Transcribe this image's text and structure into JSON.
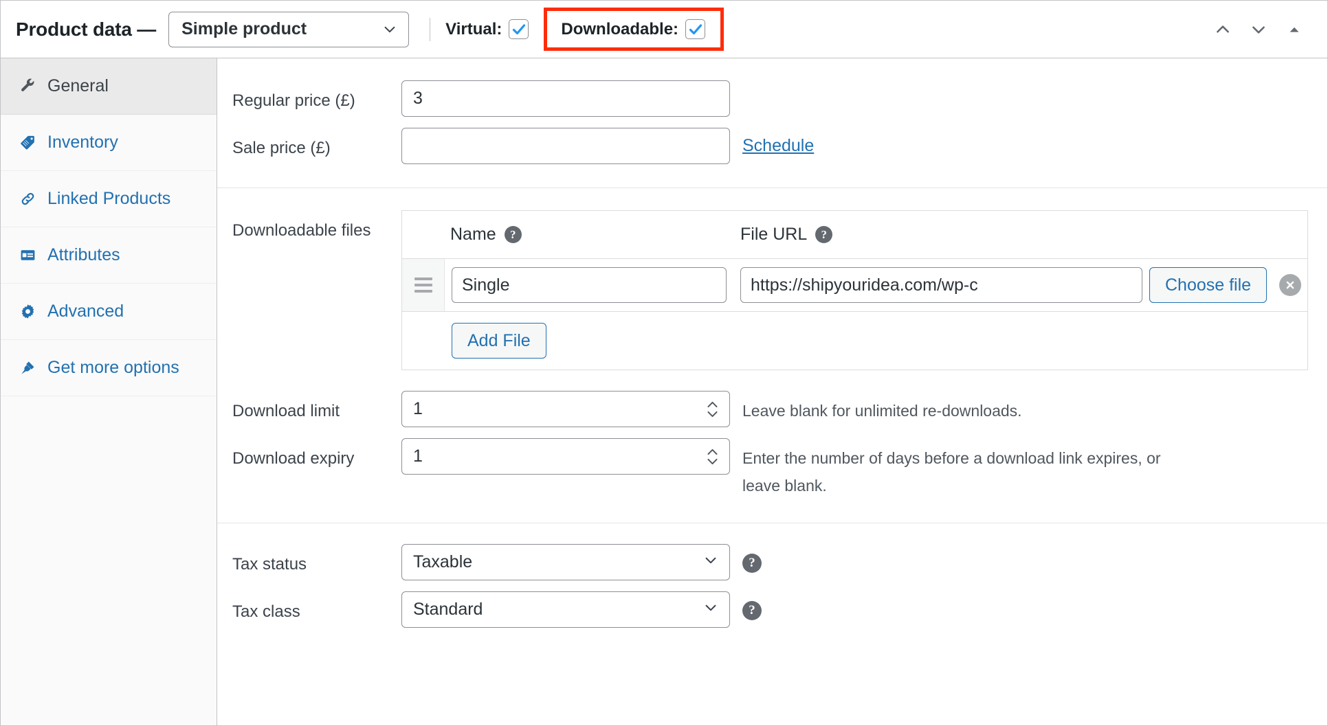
{
  "header": {
    "title": "Product data —",
    "product_type": {
      "selected": "Simple product",
      "icon": "chevron-down-icon"
    },
    "virtual": {
      "label": "Virtual:",
      "checked": true
    },
    "downloadable": {
      "label": "Downloadable:",
      "checked": true,
      "highlighted": true
    },
    "highlight_color": "#ff2d0a",
    "actions": {
      "move_up": "move-up-icon",
      "move_down": "move-down-icon",
      "collapse": "collapse-icon"
    }
  },
  "sidebar": {
    "items": [
      {
        "label": "General",
        "icon": "wrench-icon",
        "active": true
      },
      {
        "label": "Inventory",
        "icon": "tag-icon",
        "active": false
      },
      {
        "label": "Linked Products",
        "icon": "link-icon",
        "active": false
      },
      {
        "label": "Attributes",
        "icon": "attributes-icon",
        "active": false
      },
      {
        "label": "Advanced",
        "icon": "gear-icon",
        "active": false
      },
      {
        "label": "Get more options",
        "icon": "plug-icon",
        "active": false
      }
    ]
  },
  "pricing": {
    "regular_price": {
      "label": "Regular price (£)",
      "value": "3",
      "placeholder": ""
    },
    "sale_price": {
      "label": "Sale price (£)",
      "value": "",
      "placeholder": ""
    },
    "schedule_link": "Schedule"
  },
  "downloadable_files": {
    "label": "Downloadable files",
    "columns": {
      "name": "Name",
      "file_url": "File URL",
      "help_icon": "?"
    },
    "rows": [
      {
        "drag_handle": "drag-handle-icon",
        "name": "Single",
        "file_url": "https://shipyouridea.com/wp-c",
        "choose_file_label": "Choose file",
        "delete_icon": "delete-circle-icon"
      }
    ],
    "add_file_label": "Add File"
  },
  "download_limit": {
    "label": "Download limit",
    "value": "1",
    "hint": "Leave blank for unlimited re-downloads."
  },
  "download_expiry": {
    "label": "Download expiry",
    "value": "1",
    "hint": "Enter the number of days before a download link expires, or leave blank."
  },
  "tax_status": {
    "label": "Tax status",
    "selected": "Taxable",
    "help_icon": "?"
  },
  "tax_class": {
    "label": "Tax class",
    "selected": "Standard",
    "help_icon": "?"
  },
  "colors": {
    "link": "#2271b1",
    "text": "#3c434a",
    "border": "#8c8f94",
    "accent_check": "#2196f3"
  }
}
